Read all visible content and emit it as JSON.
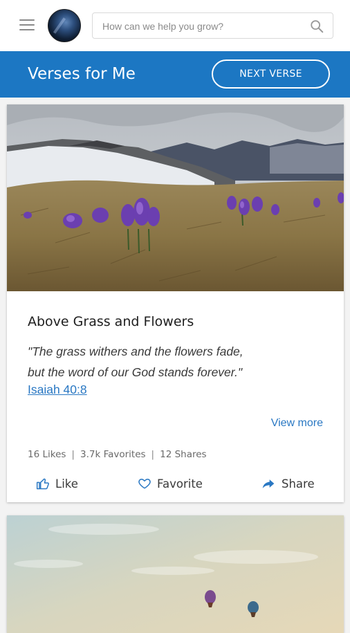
{
  "header": {
    "menu_icon": "hamburger-menu-icon",
    "avatar_icon": "avatar",
    "search": {
      "placeholder": "How can we help you grow?",
      "value": "",
      "icon": "search-icon"
    }
  },
  "banner": {
    "title": "Verses for Me",
    "next_button": "NEXT VERSE"
  },
  "cards": [
    {
      "image": "mountain-crocus-photo",
      "title": "Above Grass and Flowers",
      "verse_line1": "\"The grass withers and the flowers fade,",
      "verse_line2": "but the word of our God stands forever.\"",
      "reference": "Isaiah 40:8",
      "view_more": "View more",
      "stats": {
        "likes": "16 Likes",
        "favorites": "3.7k Favorites",
        "shares": "12 Shares",
        "separator": "|"
      },
      "actions": {
        "like": "Like",
        "favorite": "Favorite",
        "share": "Share"
      }
    },
    {
      "image": "hot-air-balloons-photo"
    }
  ],
  "colors": {
    "brand_blue": "#1c77c3",
    "link_blue": "#2a78c3"
  }
}
